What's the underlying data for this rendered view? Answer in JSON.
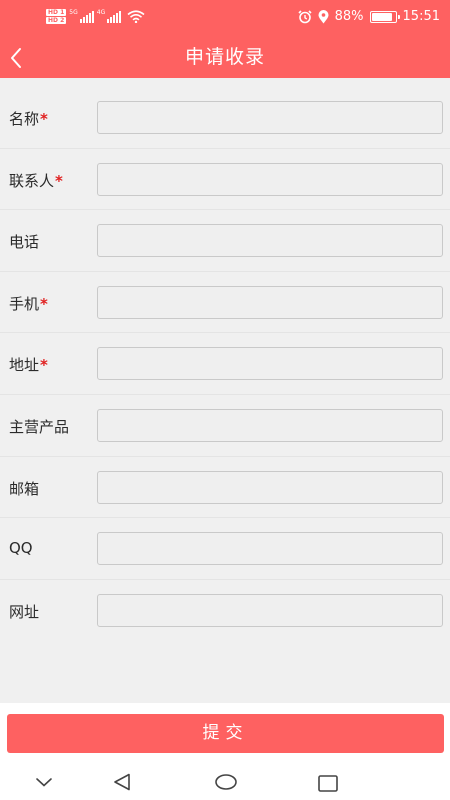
{
  "status_bar": {
    "hd_top": "HD",
    "hd_top_num": "1",
    "hd_bottom": "HD",
    "hd_bottom_num": "2",
    "network_1": "5G",
    "network_2": "4G",
    "battery_percent": "88%",
    "battery_level": 0.88,
    "time": "15:51"
  },
  "header": {
    "title": "申请收录"
  },
  "form": {
    "fields": [
      {
        "label": "名称",
        "required": true
      },
      {
        "label": "联系人",
        "required": true
      },
      {
        "label": "电话",
        "required": false
      },
      {
        "label": "手机",
        "required": true
      },
      {
        "label": "地址",
        "required": true
      },
      {
        "label": "主营产品",
        "required": false
      },
      {
        "label": "邮箱",
        "required": false
      },
      {
        "label": "QQ",
        "required": false
      },
      {
        "label": "网址",
        "required": false
      }
    ],
    "required_mark": "*"
  },
  "submit_label": "提交",
  "colors": {
    "accent": "#fe6161",
    "required": "#e02020",
    "background": "#f0f0f0"
  },
  "icons": {
    "back": "chevron-left-icon",
    "sys_menu": "chevron-down-icon",
    "sys_back": "triangle-back-icon",
    "sys_home": "circle-home-icon",
    "sys_recent": "square-recent-icon"
  }
}
